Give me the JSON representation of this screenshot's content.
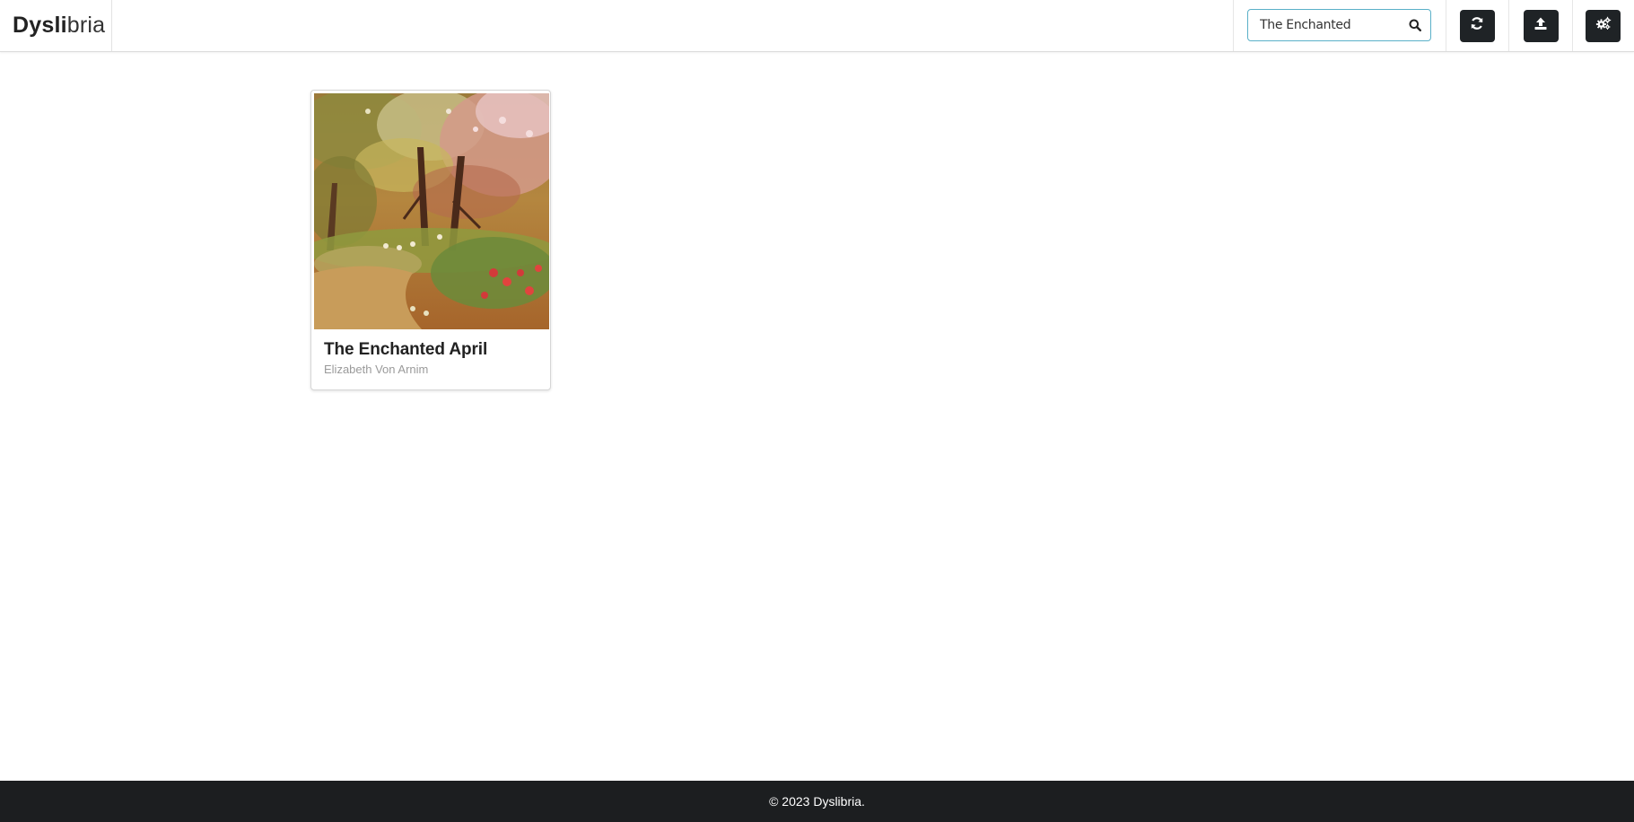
{
  "brand": {
    "part_bold": "Dysli",
    "part_light": "bria"
  },
  "search": {
    "value": "The Enchanted",
    "placeholder": "Search",
    "icon": "search-icon"
  },
  "toolbar": {
    "refresh_icon": "refresh-icon",
    "upload_icon": "upload-icon",
    "settings_icon": "gears-icon",
    "button_color": "#1f2326"
  },
  "results": [
    {
      "title": "The Enchanted April",
      "author": "Elizabeth Von Arnim"
    }
  ],
  "footer": {
    "text": "© 2023 Dyslibria."
  },
  "colors": {
    "accent_border": "#5ab0c8",
    "footer_bg": "#1c1e20"
  }
}
